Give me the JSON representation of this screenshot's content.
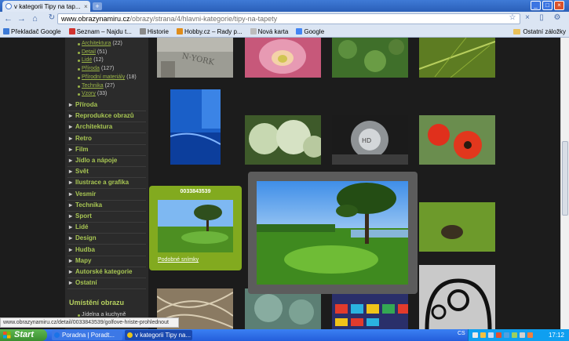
{
  "browser": {
    "tab_title": "v kategorii Tipy na tap...",
    "tab_close": "×",
    "new_tab": "+",
    "window_controls": [
      "_",
      "□",
      "×"
    ],
    "url_domain": "www.obrazynamiru.cz",
    "url_path": "/obrazy/strana/4/hlavni-kategorie/tipy-na-tapety",
    "back_icon": "←",
    "forward_icon": "→",
    "home_icon": "⌂",
    "reload_icon": "↻",
    "star_icon": "☆",
    "stop_icon": "×",
    "page_menu_icon": "▯",
    "wrench_icon": "⚙"
  },
  "bookmarks": {
    "items": [
      {
        "label": "Překladač Google",
        "color": "#3b79d6"
      },
      {
        "label": "Seznam – Najdu t...",
        "color": "#d1322e"
      },
      {
        "label": "Historie",
        "color": "#8a8a8a"
      },
      {
        "label": "Hobby.cz – Rady p...",
        "color": "#e08d1b"
      },
      {
        "label": "Nová karta",
        "color": "#bcbcbc"
      },
      {
        "label": "Google",
        "color": "#4285f4"
      }
    ],
    "other": "Ostatní záložky"
  },
  "sidebar": {
    "subitems": [
      {
        "label": "Architektura",
        "count": "(22)"
      },
      {
        "label": "Detail",
        "count": "(51)"
      },
      {
        "label": "Lidé",
        "count": "(12)"
      },
      {
        "label": "Příroda",
        "count": "(127)"
      },
      {
        "label": "Přírodní materiály",
        "count": "(18)"
      },
      {
        "label": "Technika",
        "count": "(27)"
      },
      {
        "label": "Vzory",
        "count": "(33)"
      }
    ],
    "categories": [
      "Příroda",
      "Reprodukce obrazů",
      "Architektura",
      "Retro",
      "Film",
      "Jídlo a nápoje",
      "Svět",
      "Ilustrace a grafika",
      "Vesmír",
      "Technika",
      "Sport",
      "Lidé",
      "Design",
      "Hudba",
      "Mapy",
      "Autorské kategorie",
      "Ostatní"
    ],
    "section_heading": "Umístění obrazu",
    "location_item": "Jídelna a kuchyně"
  },
  "popup": {
    "image_id": "0033843539",
    "similar_link": "Podobné snímky"
  },
  "status_text": "www.obrazynamiru.cz/detail/0033843539/golfove-hriste-prohlednout",
  "taskbar": {
    "start": "Start",
    "buttons": [
      {
        "label": "Poradna | Poradt...",
        "color": "#2a62d3"
      },
      {
        "label": "v kategorii Tipy na...",
        "color": "#1a49b0"
      }
    ],
    "lang": "CS",
    "clock": "17:12"
  }
}
